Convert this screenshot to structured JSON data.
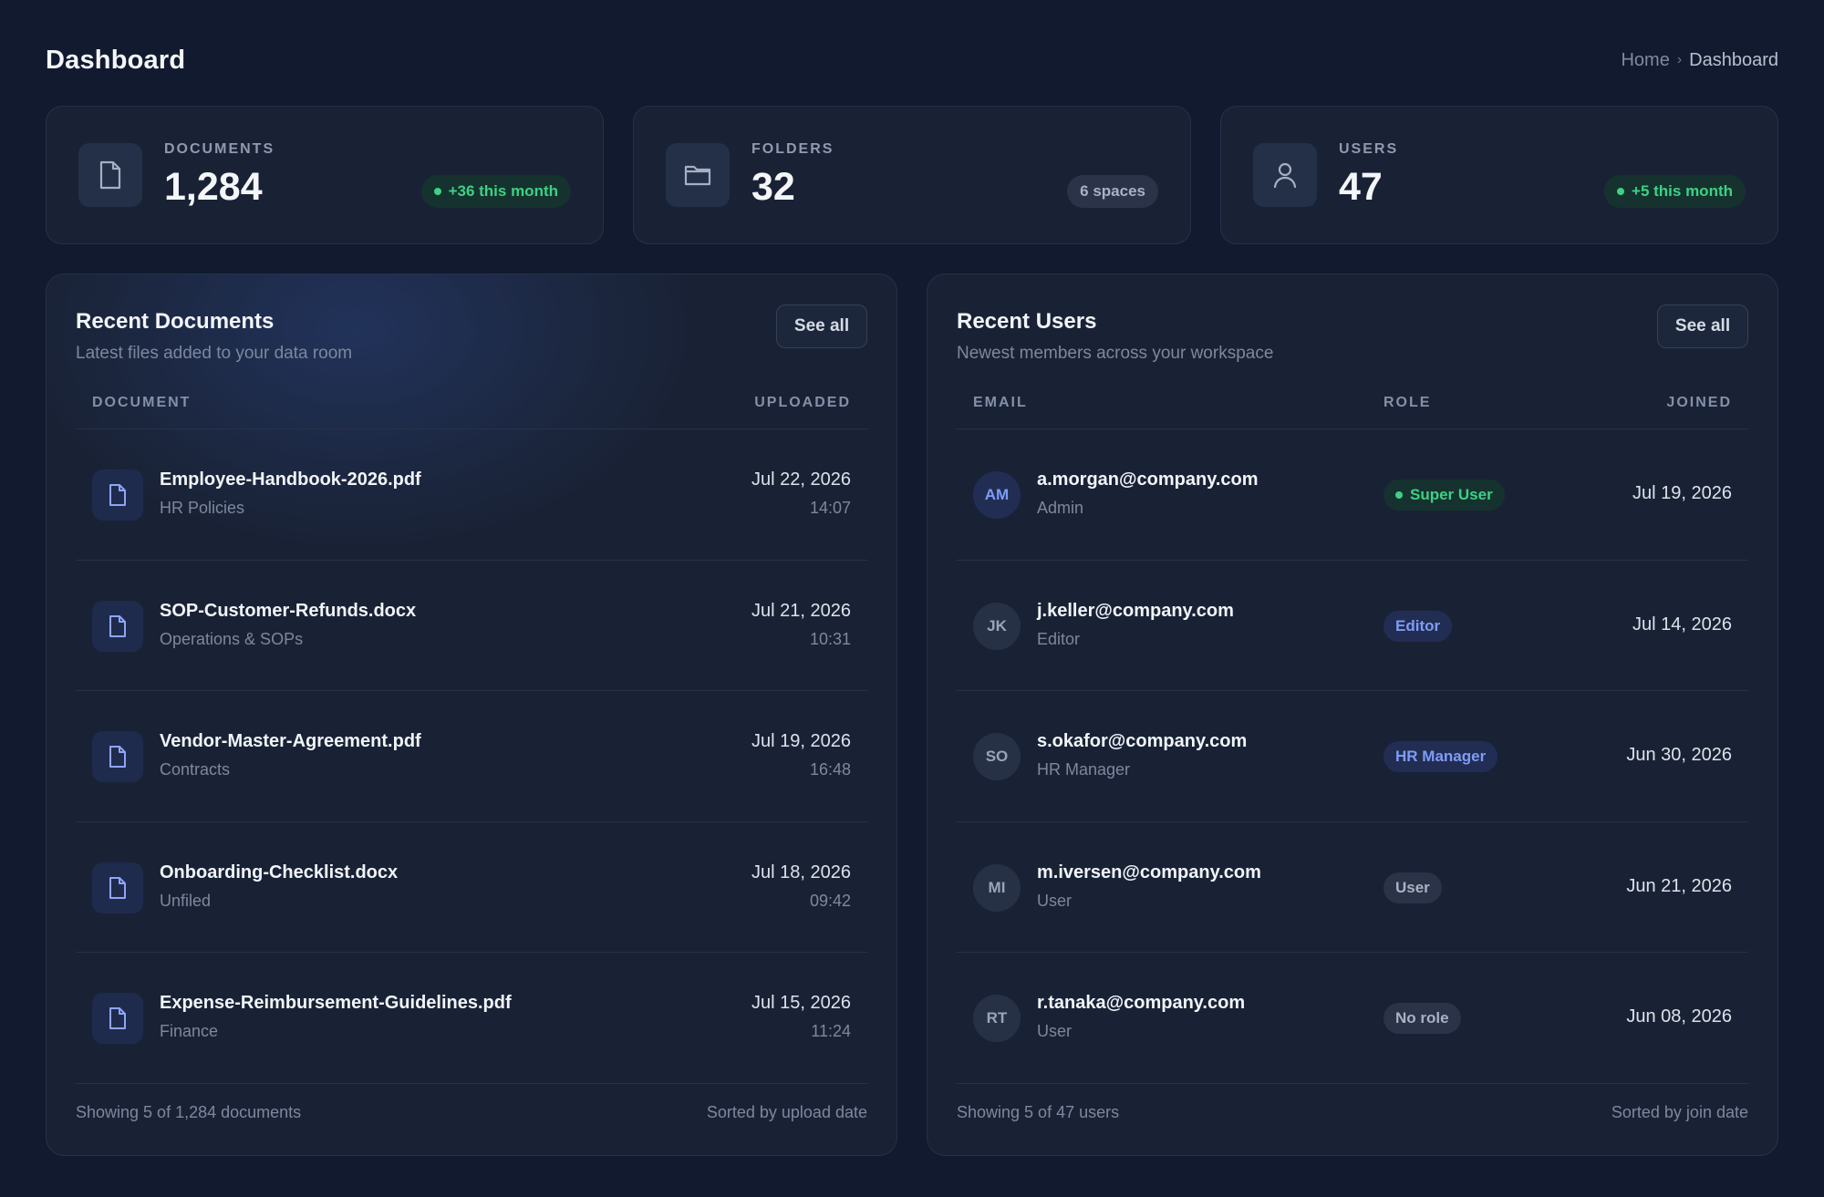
{
  "header": {
    "title": "Dashboard",
    "breadcrumb": {
      "home": "Home",
      "separator": "›",
      "current": "Dashboard"
    }
  },
  "stats": [
    {
      "label": "DOCUMENTS",
      "value": "1,284",
      "chip": "+36 this month",
      "icon": "document-icon"
    },
    {
      "label": "FOLDERS",
      "value": "32",
      "chip": "6 spaces",
      "icon": "folder-icon"
    },
    {
      "label": "USERS",
      "value": "47",
      "chip": "+5 this month",
      "icon": "user-icon"
    }
  ],
  "recent_documents": {
    "title": "Recent Documents",
    "subtitle": "Latest files added to your data room",
    "see_all": "See all",
    "columns": {
      "document": "DOCUMENT",
      "uploaded": "UPLOADED"
    },
    "rows": [
      {
        "name": "Employee-Handbook-2026.pdf",
        "folder": "HR Policies",
        "date": "Jul 22, 2026",
        "time": "14:07"
      },
      {
        "name": "SOP-Customer-Refunds.docx",
        "folder": "Operations & SOPs",
        "date": "Jul 21, 2026",
        "time": "10:31"
      },
      {
        "name": "Vendor-Master-Agreement.pdf",
        "folder": "Contracts",
        "date": "Jul 19, 2026",
        "time": "16:48"
      },
      {
        "name": "Onboarding-Checklist.docx",
        "folder": "Unfiled",
        "date": "Jul 18, 2026",
        "time": "09:42"
      },
      {
        "name": "Expense-Reimbursement-Guidelines.pdf",
        "folder": "Finance",
        "date": "Jul 15, 2026",
        "time": "11:24"
      }
    ],
    "footer_left": "Showing 5 of 1,284 documents",
    "footer_right": "Sorted by upload date"
  },
  "recent_users": {
    "title": "Recent Users",
    "subtitle": "Newest members across your workspace",
    "see_all": "See all",
    "columns": {
      "email": "EMAIL",
      "role": "ROLE",
      "joined": "JOINED"
    },
    "rows": [
      {
        "initials": "AM",
        "email": "a.morgan@company.com",
        "sub": "Admin",
        "role": "Super User",
        "joined": "Jul 19, 2026"
      },
      {
        "initials": "JK",
        "email": "j.keller@company.com",
        "sub": "Editor",
        "role": "Editor",
        "joined": "Jul 14, 2026"
      },
      {
        "initials": "SO",
        "email": "s.okafor@company.com",
        "sub": "HR Manager",
        "role": "HR Manager",
        "joined": "Jun 30, 2026"
      },
      {
        "initials": "MI",
        "email": "m.iversen@company.com",
        "sub": "User",
        "role": "User",
        "joined": "Jun 21, 2026"
      },
      {
        "initials": "RT",
        "email": "r.tanaka@company.com",
        "sub": "User",
        "role": "No role",
        "joined": "Jun 08, 2026"
      }
    ],
    "footer_left": "Showing 5 of 47 users",
    "footer_right": "Sorted by join date"
  },
  "colors": {
    "background": "#111a2e",
    "card": "#192235",
    "accent_green": "#3ed184",
    "accent_blue": "#7f9cf5"
  }
}
